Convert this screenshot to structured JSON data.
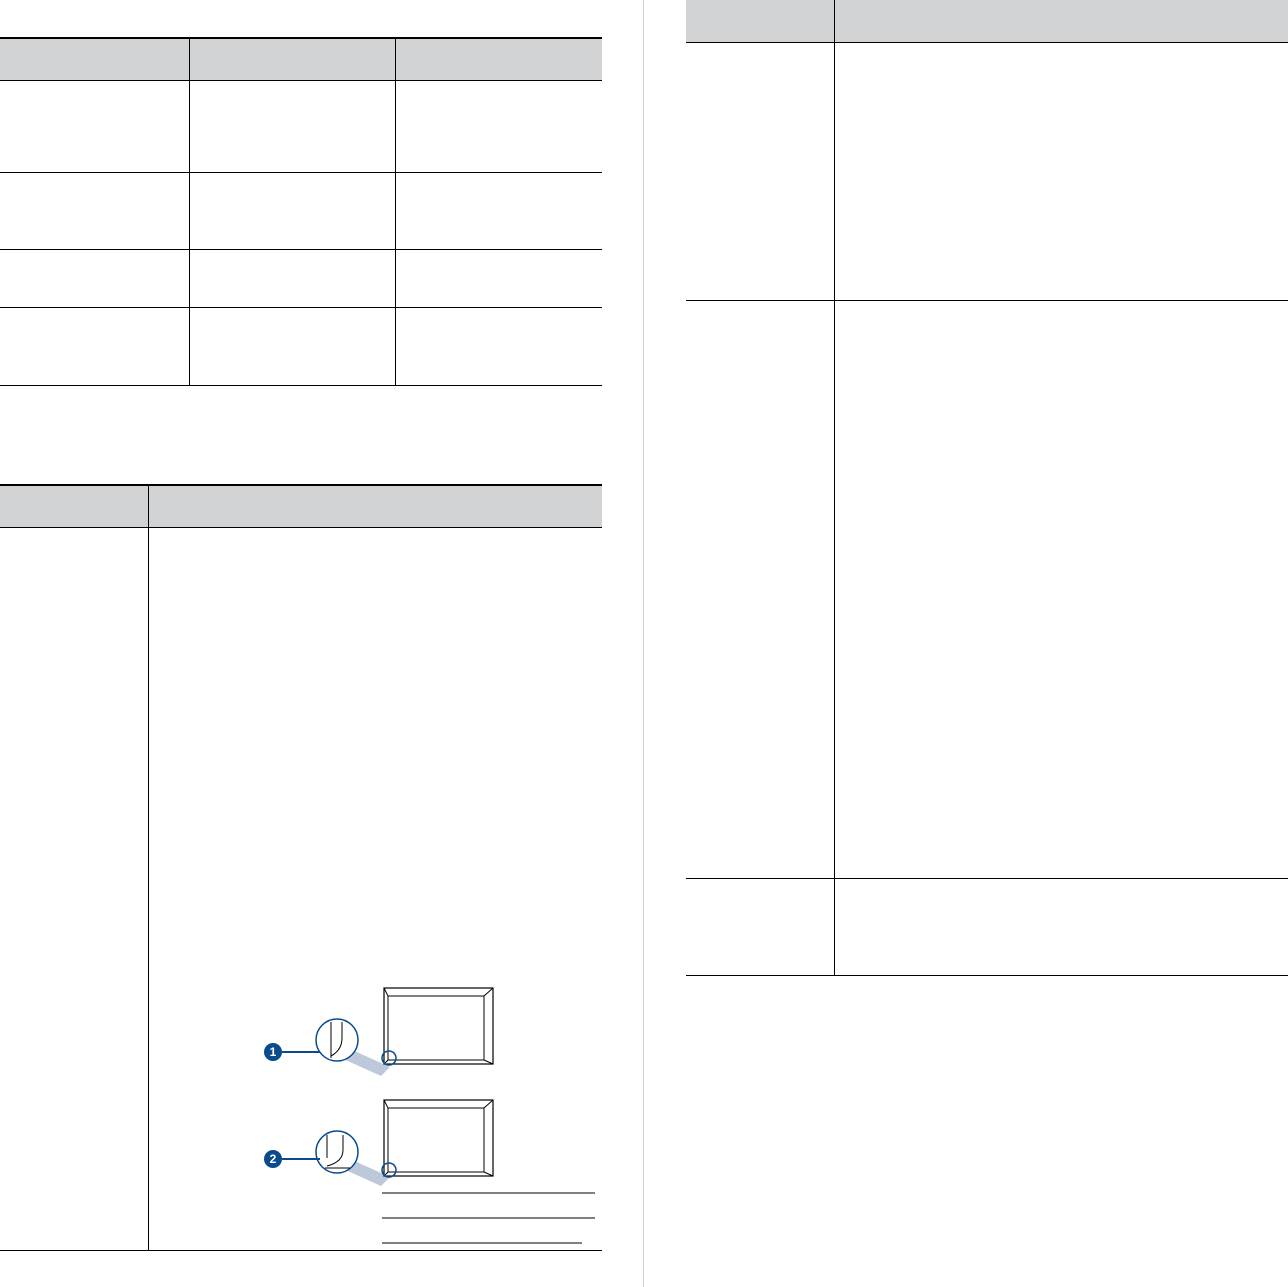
{
  "left_table_top": {
    "header": [
      "",
      "",
      ""
    ],
    "rows": [
      [
        "",
        "",
        ""
      ],
      [
        "",
        "",
        ""
      ],
      [
        "",
        "",
        ""
      ],
      [
        "",
        "",
        ""
      ]
    ]
  },
  "left_table_bottom": {
    "header": [
      "",
      ""
    ],
    "rows": [
      [
        "",
        ""
      ]
    ],
    "diagram": {
      "callout_1": "1",
      "callout_2": "2",
      "accent_color": "#0a4b8c",
      "magnifier_color": "#b6c3d6"
    }
  },
  "right_table": {
    "header": [
      "",
      ""
    ],
    "rows": [
      [
        "",
        ""
      ],
      [
        "",
        ""
      ],
      [
        "",
        ""
      ]
    ]
  },
  "colors": {
    "header_fill": "#d1d2d4",
    "rule": "#000000",
    "page_divider": "#cfd0d2"
  }
}
